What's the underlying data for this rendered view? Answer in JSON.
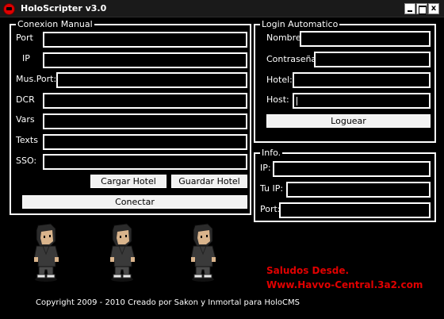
{
  "window": {
    "title": "HoloScripter v3.0",
    "controls": {
      "minimize": "minimize",
      "maximize": "maximize",
      "close": "x"
    }
  },
  "conexion_manual": {
    "title": "Conexion Manual",
    "fields": [
      {
        "label": "Port",
        "value": ""
      },
      {
        "label": "IP",
        "value": ""
      },
      {
        "label": "Mus.Port:",
        "value": ""
      },
      {
        "label": "DCR",
        "value": ""
      },
      {
        "label": "Vars",
        "value": ""
      },
      {
        "label": "Texts",
        "value": ""
      },
      {
        "label": "SSO:",
        "value": ""
      }
    ],
    "cargar_button": "Cargar Hotel",
    "guardar_button": "Guardar Hotel",
    "conectar_button": "Conectar"
  },
  "login_automatico": {
    "title": "Login Automatico",
    "fields": [
      {
        "label": "Nombre:",
        "value": ""
      },
      {
        "label": "Contraseña:",
        "value": ""
      },
      {
        "label": "Hotel:",
        "value": ""
      },
      {
        "label": "Host:",
        "value": ""
      }
    ],
    "loguear_button": "Loguear"
  },
  "info": {
    "title": "Info.",
    "fields": [
      {
        "label": "IP:",
        "value": ""
      },
      {
        "label": "Tu IP:",
        "value": ""
      },
      {
        "label": "Port:",
        "value": ""
      }
    ]
  },
  "greeting": {
    "line1": "Saludos Desde.",
    "line2": "Www.Havvo-Central.3a2.com",
    "color": "#e00000"
  },
  "footer": {
    "copyright": "Copyright 2009 - 2010 Creado por Sakon y Inmortal para HoloCMS"
  },
  "colors": {
    "background": "#000000",
    "foreground": "#ffffff",
    "button_face": "#f2f2f2"
  }
}
